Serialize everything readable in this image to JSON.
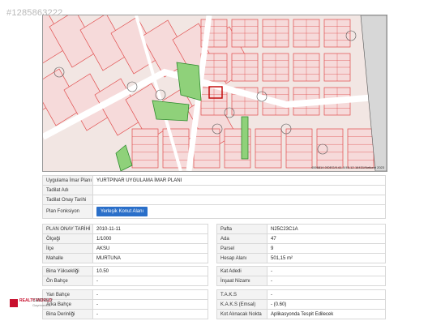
{
  "watermark": "#1285863222",
  "map": {
    "number_label": "18",
    "coord_text": "4066814.0/DEG/0-61-0/45-12-16431/Netkent 2023",
    "parcel_labels": [
      "E=1.50",
      "E=0.10",
      "2+0",
      "2.90",
      "12"
    ]
  },
  "plan": {
    "rows": [
      {
        "label": "Uygulama İmar Planı",
        "value": "YURTPINAR UYGULAMA İMAR PLANI"
      },
      {
        "label": "Tadilat Adı",
        "value": ""
      },
      {
        "label": "Tadilat Onay Tarihi",
        "value": ""
      },
      {
        "label": "Plan Fonksiyon",
        "button": "Yerleşik Konut Alanı"
      }
    ]
  },
  "left_info": {
    "group1": [
      {
        "label": "PLAN ONAY TARİHİ",
        "value": "2010-11-11"
      },
      {
        "label": "Ölçeği",
        "value": "1/1000"
      },
      {
        "label": "İlçe",
        "value": "AKSU"
      },
      {
        "label": "Mahalle",
        "value": "MURTUNA"
      }
    ],
    "group2": [
      {
        "label": "Bina Yüksekliği",
        "value": "10.50"
      },
      {
        "label": "Ön Bahçe",
        "value": "-"
      }
    ],
    "group3": [
      {
        "label": "Yan Bahçe",
        "value": "-"
      },
      {
        "label": "Arka Bahçe",
        "value": "-"
      },
      {
        "label": "Bina Derinliği",
        "value": "-"
      }
    ]
  },
  "right_info": {
    "group1": [
      {
        "label": "Pafta",
        "value": "N25C23C1A"
      },
      {
        "label": "Ada",
        "value": "47"
      },
      {
        "label": "Parsel",
        "value": "9"
      },
      {
        "label": "Hesap Alanı",
        "value": "501,15 m²"
      }
    ],
    "group2": [
      {
        "label": "Kat Adedi",
        "value": "-"
      },
      {
        "label": "İnşaat Nizamı",
        "value": "-"
      }
    ],
    "group3": [
      {
        "label": "T.A.K.S",
        "value": "-"
      },
      {
        "label": "K.A.K.S (Emsal)",
        "value": "- (0.60)"
      },
      {
        "label": "Kot Alınacak Nokta",
        "value": "Aplikasyonda Tespit Edilecek"
      }
    ]
  },
  "footer_logo": {
    "brand": "REALTY WORLD",
    "office": "CENTER 2",
    "tag": "Gayrimenkul"
  }
}
